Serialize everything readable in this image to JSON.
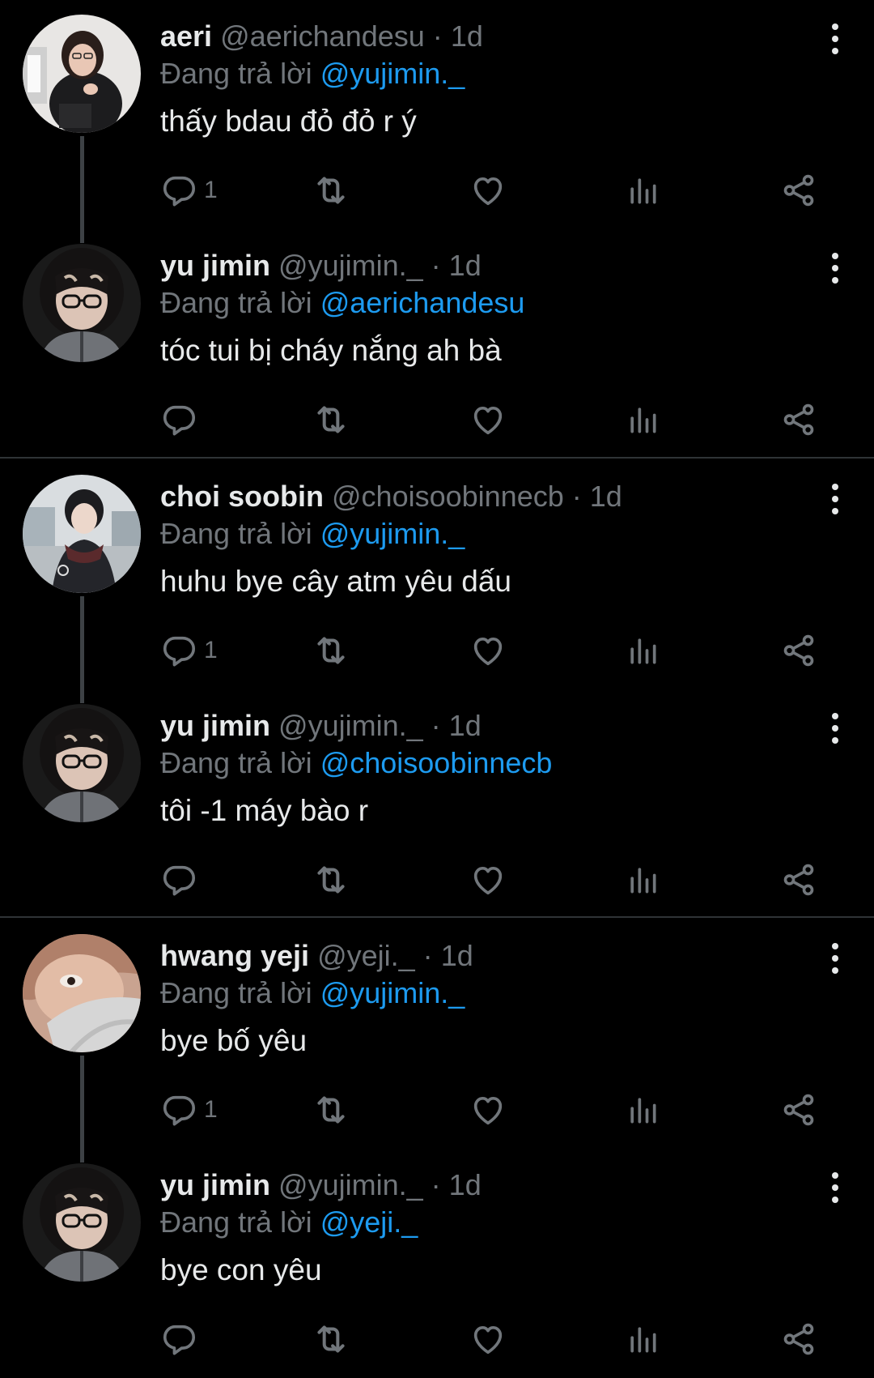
{
  "colors": {
    "background": "#000000",
    "text_primary": "#e7e9ea",
    "text_secondary": "#71767b",
    "accent": "#1d9bf0",
    "divider": "#2f3336"
  },
  "icons": {
    "reply": "speech-bubble-icon",
    "retweet": "retweet-arrows-icon",
    "like": "heart-icon",
    "views": "bar-chart-icon",
    "share": "share-nodes-icon",
    "more": "vertical-dots-icon"
  },
  "threads": [
    {
      "tweets": [
        {
          "name": "aeri",
          "handle": "@aerichandesu",
          "dot": "·",
          "time": "1d",
          "reply_prefix": "Đang trả lời",
          "reply_to": "@yujimin._",
          "text": "thấy bdau đỏ đỏ r ý",
          "reply_count": "1"
        },
        {
          "name": "yu jimin",
          "handle": "@yujimin._",
          "dot": "·",
          "time": "1d",
          "reply_prefix": "Đang trả lời",
          "reply_to": "@aerichandesu",
          "text": "tóc tui bị cháy nắng ah bà",
          "reply_count": ""
        }
      ]
    },
    {
      "tweets": [
        {
          "name": "choi soobin",
          "handle": "@choisoobinnecb",
          "dot": "·",
          "time": "1d",
          "reply_prefix": "Đang trả lời",
          "reply_to": "@yujimin._",
          "text": "huhu bye cây atm yêu dấu",
          "reply_count": "1"
        },
        {
          "name": "yu jimin",
          "handle": "@yujimin._",
          "dot": "·",
          "time": "1d",
          "reply_prefix": "Đang trả lời",
          "reply_to": "@choisoobinnecb",
          "text": "tôi -1 máy bào r",
          "reply_count": ""
        }
      ]
    },
    {
      "tweets": [
        {
          "name": "hwang yeji",
          "handle": "@yeji._",
          "dot": "·",
          "time": "1d",
          "reply_prefix": "Đang trả lời",
          "reply_to": "@yujimin._",
          "text": "bye bố yêu",
          "reply_count": "1"
        },
        {
          "name": "yu jimin",
          "handle": "@yujimin._",
          "dot": "·",
          "time": "1d",
          "reply_prefix": "Đang trả lời",
          "reply_to": "@yeji._",
          "text": "bye con yêu",
          "reply_count": ""
        }
      ]
    }
  ]
}
